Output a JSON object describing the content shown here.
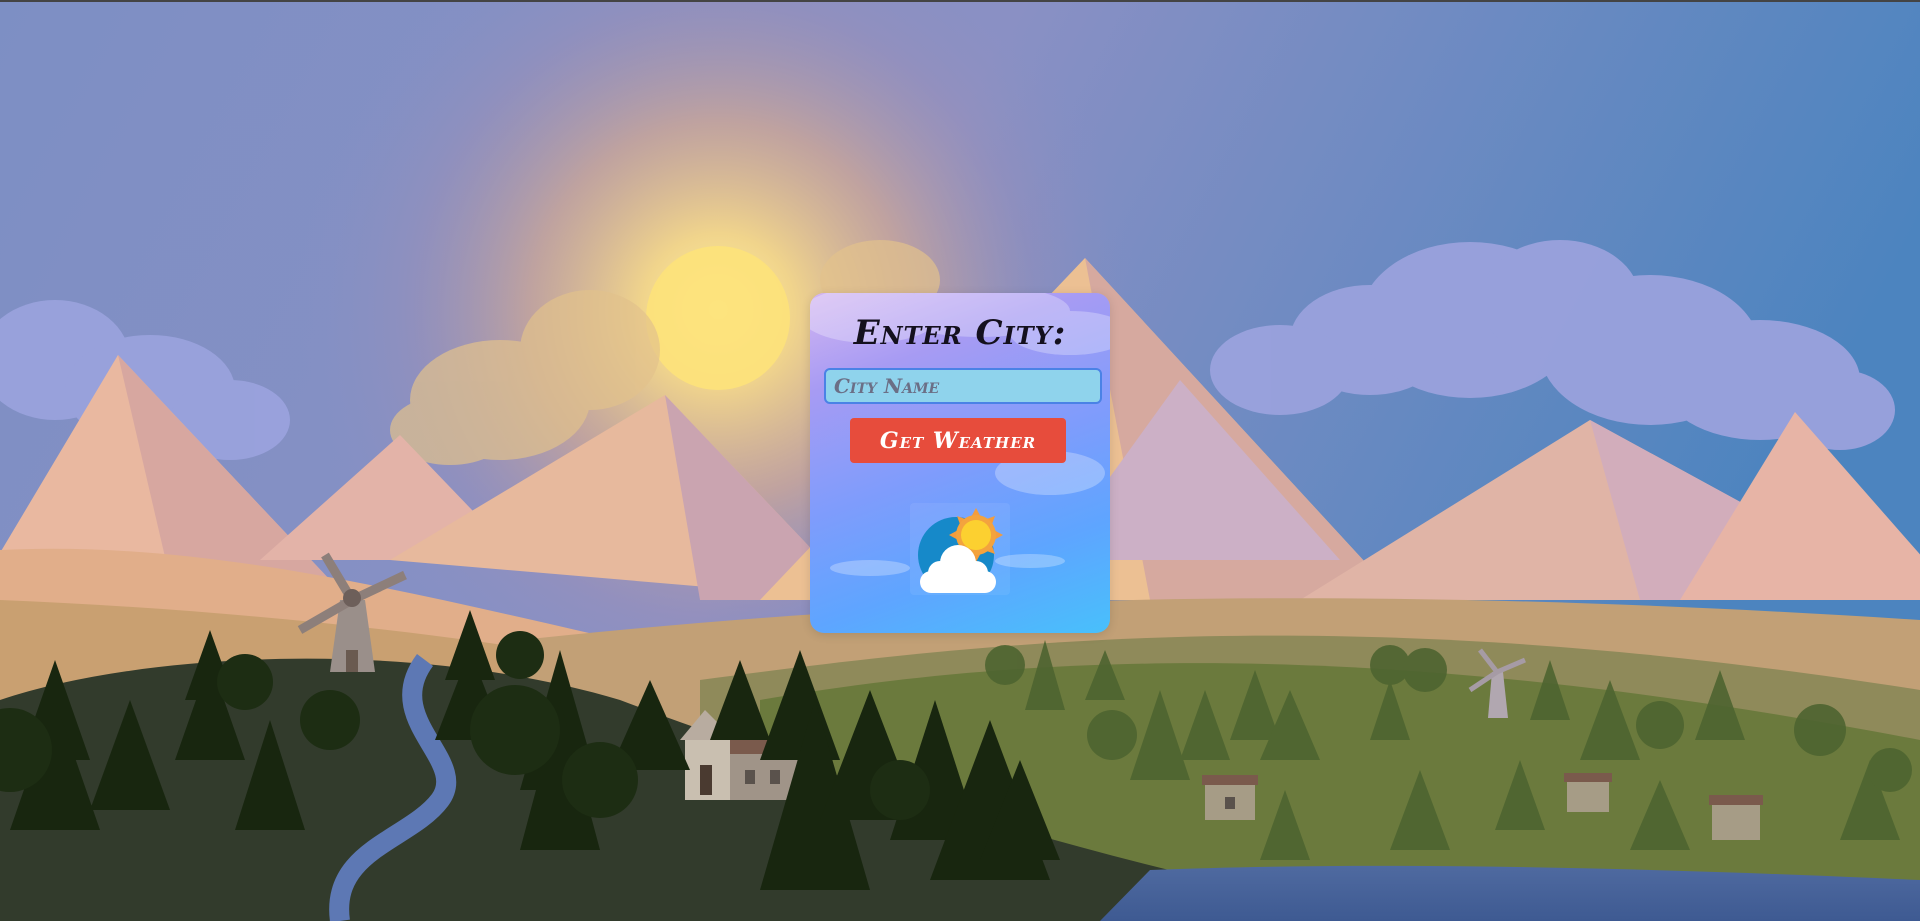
{
  "card": {
    "title": "Enter City:"
  },
  "search": {
    "placeholder": "City Name",
    "value": ""
  },
  "actions": {
    "get_weather_label": "Get Weather"
  },
  "weather": {
    "icon": "partly-cloudy-day-icon"
  },
  "colors": {
    "button": "#e74c3c",
    "input_bg": "#8fd3ec",
    "input_border": "#4a82e6",
    "sky_top": "#4f86c0",
    "sun": "#fde47e"
  }
}
